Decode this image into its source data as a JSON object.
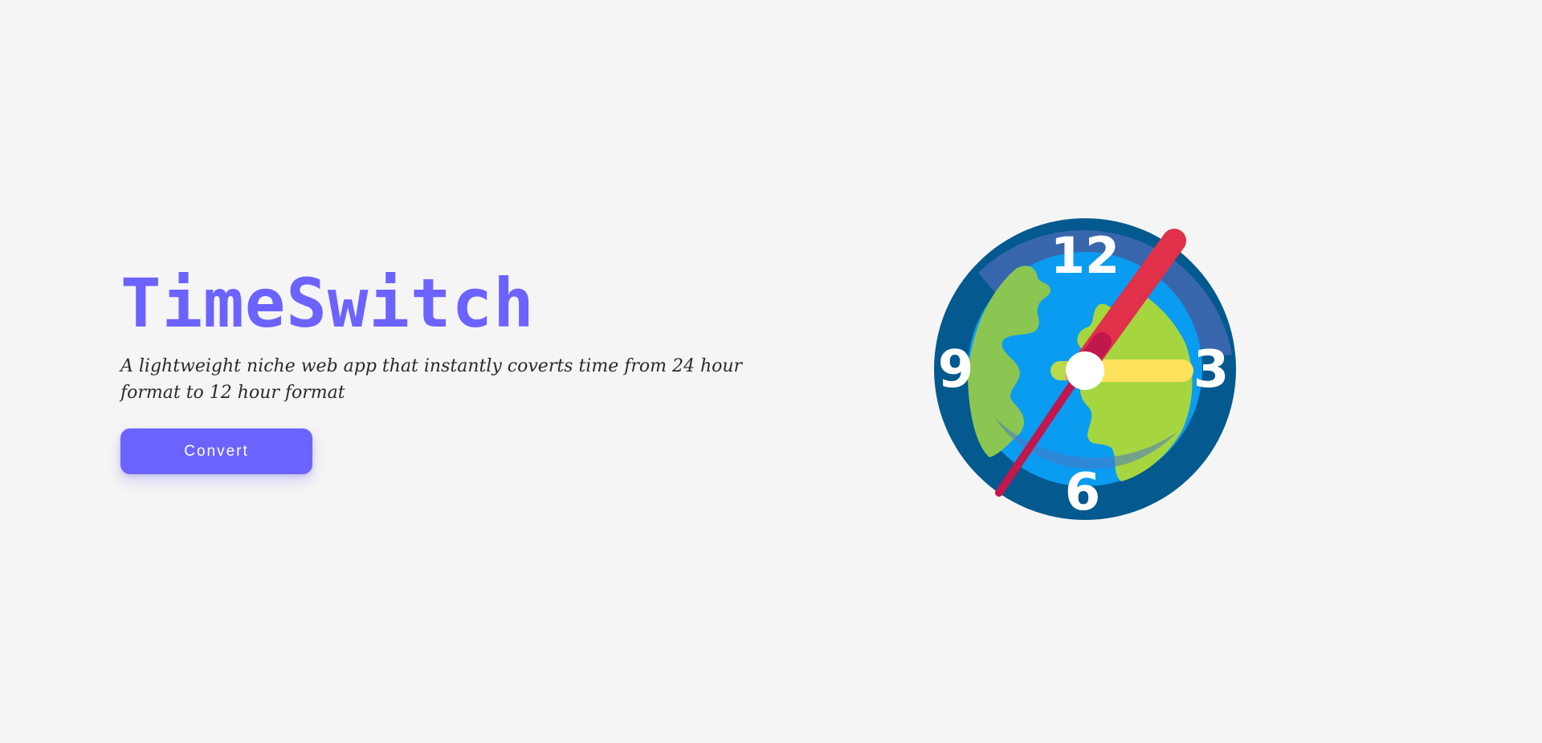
{
  "app": {
    "title": "TimeSwitch",
    "tagline": "A lightweight niche web app that instantly coverts time from 24 hour format to 12 hour format",
    "convert_label": "Convert"
  },
  "illustration": {
    "icon": "globe-clock-icon",
    "numbers": {
      "twelve": "12",
      "three": "3",
      "six": "6",
      "nine": "9"
    }
  },
  "colors": {
    "accent": "#6c63ff",
    "background": "#f5f5f5",
    "clock_rim": "#04598f",
    "ocean": "#0a9cf0",
    "land": "#a6d63f",
    "minute_hand": "#e0304a",
    "hour_hand": "#ffe25b"
  }
}
